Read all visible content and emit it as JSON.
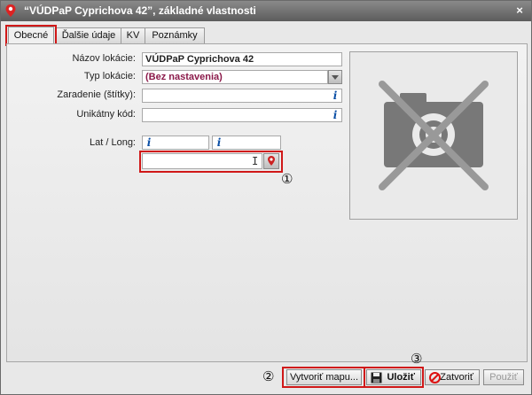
{
  "window": {
    "title": "“VÚDPaP Cyprichova 42”, základné vlastnosti",
    "close": "×"
  },
  "tabs": [
    {
      "label": "Obecné",
      "active": true
    },
    {
      "label": "Ďalšie údaje",
      "active": false
    },
    {
      "label": "KV",
      "active": false
    },
    {
      "label": "Poznámky",
      "active": false
    }
  ],
  "form": {
    "name": {
      "label": "Názov lokácie:",
      "value": "VÚDPaP Cyprichova 42"
    },
    "type": {
      "label": "Typ lokácie:",
      "value": "(Bez nastavenia)"
    },
    "tags": {
      "label": "Zaradenie (štítky):",
      "value": ""
    },
    "code": {
      "label": "Unikátny kód:",
      "value": ""
    },
    "latlong": {
      "label": "Lat / Long:",
      "lat": "",
      "long": "",
      "address": ""
    }
  },
  "annotations": {
    "one": "①",
    "two": "②",
    "three": "③"
  },
  "buttons": {
    "create_map": "Vytvoriť mapu...",
    "save": "Uložiť",
    "close": "Zatvoriť",
    "apply": "Použiť"
  },
  "colors": {
    "accent_red": "#d01818",
    "type_value": "#8b1a4a",
    "info": "#0b4fa5"
  }
}
